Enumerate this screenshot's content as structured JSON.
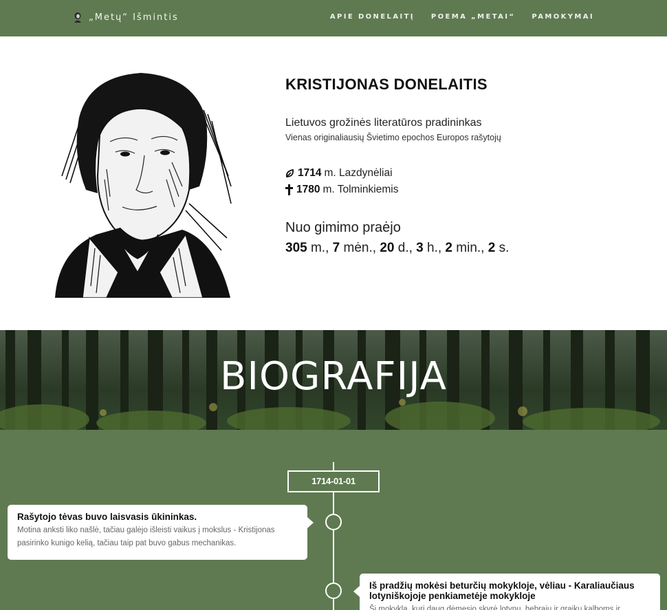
{
  "nav": {
    "brand": "„Metų“ Išmintis",
    "links": [
      "APIE DONELAITĮ",
      "POEMA „METAI“",
      "PAMOKYMAI"
    ]
  },
  "hero": {
    "name": "KRISTIJONAS DONELAITIS",
    "subtitle": "Lietuvos grožinės literatūros pradininkas",
    "subtitle2": "Vienas originaliausių Švietimo epochos Europos rašytojų",
    "born_year": "1714",
    "born_place": "m. Lazdynėliai",
    "died_year": "1780",
    "died_place": "m. Tolminkiemis",
    "since_label": "Nuo gimimo praėjo",
    "counter": {
      "years": "305",
      "years_unit": "m.,",
      "months": "7",
      "months_unit": "mėn.,",
      "days": "20",
      "days_unit": "d.,",
      "hours": "3",
      "hours_unit": "h.,",
      "minutes": "2",
      "minutes_unit": "min.,",
      "seconds": "2",
      "seconds_unit": "s."
    }
  },
  "banner": {
    "title": "BIOGRAFIJA"
  },
  "timeline": {
    "date": "1714-01-01",
    "items": [
      {
        "title": "Rašytojo tėvas buvo laisvasis ūkininkas.",
        "text": "Motina anksti liko našlė, tačiau galėjo išleisti vaikus į mokslus - Kristijonas pasirinko kunigo kelią, tačiau taip pat buvo gabus mechanikas."
      },
      {
        "title": "Iš pradžių mokėsi beturčių mokykloje, vėliau - Karaliaučiaus lotyniškojoje penkiametėje mokykloje",
        "text": "Ši mokykla, kuri daug dėmesio skyrė lotynų, hebrajų ir graikų kalboms ir"
      }
    ]
  },
  "colors": {
    "green": "#5f7a51",
    "white": "#ffffff"
  }
}
